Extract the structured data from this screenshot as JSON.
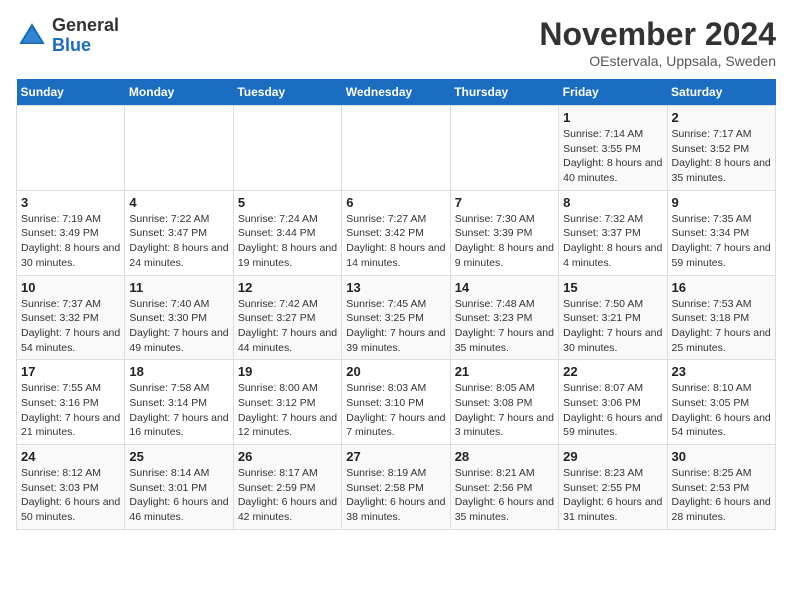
{
  "logo": {
    "general": "General",
    "blue": "Blue"
  },
  "title": "November 2024",
  "subtitle": "OEstervala, Uppsala, Sweden",
  "days_of_week": [
    "Sunday",
    "Monday",
    "Tuesday",
    "Wednesday",
    "Thursday",
    "Friday",
    "Saturday"
  ],
  "weeks": [
    [
      {
        "day": "",
        "info": ""
      },
      {
        "day": "",
        "info": ""
      },
      {
        "day": "",
        "info": ""
      },
      {
        "day": "",
        "info": ""
      },
      {
        "day": "",
        "info": ""
      },
      {
        "day": "1",
        "info": "Sunrise: 7:14 AM\nSunset: 3:55 PM\nDaylight: 8 hours and 40 minutes."
      },
      {
        "day": "2",
        "info": "Sunrise: 7:17 AM\nSunset: 3:52 PM\nDaylight: 8 hours and 35 minutes."
      }
    ],
    [
      {
        "day": "3",
        "info": "Sunrise: 7:19 AM\nSunset: 3:49 PM\nDaylight: 8 hours and 30 minutes."
      },
      {
        "day": "4",
        "info": "Sunrise: 7:22 AM\nSunset: 3:47 PM\nDaylight: 8 hours and 24 minutes."
      },
      {
        "day": "5",
        "info": "Sunrise: 7:24 AM\nSunset: 3:44 PM\nDaylight: 8 hours and 19 minutes."
      },
      {
        "day": "6",
        "info": "Sunrise: 7:27 AM\nSunset: 3:42 PM\nDaylight: 8 hours and 14 minutes."
      },
      {
        "day": "7",
        "info": "Sunrise: 7:30 AM\nSunset: 3:39 PM\nDaylight: 8 hours and 9 minutes."
      },
      {
        "day": "8",
        "info": "Sunrise: 7:32 AM\nSunset: 3:37 PM\nDaylight: 8 hours and 4 minutes."
      },
      {
        "day": "9",
        "info": "Sunrise: 7:35 AM\nSunset: 3:34 PM\nDaylight: 7 hours and 59 minutes."
      }
    ],
    [
      {
        "day": "10",
        "info": "Sunrise: 7:37 AM\nSunset: 3:32 PM\nDaylight: 7 hours and 54 minutes."
      },
      {
        "day": "11",
        "info": "Sunrise: 7:40 AM\nSunset: 3:30 PM\nDaylight: 7 hours and 49 minutes."
      },
      {
        "day": "12",
        "info": "Sunrise: 7:42 AM\nSunset: 3:27 PM\nDaylight: 7 hours and 44 minutes."
      },
      {
        "day": "13",
        "info": "Sunrise: 7:45 AM\nSunset: 3:25 PM\nDaylight: 7 hours and 39 minutes."
      },
      {
        "day": "14",
        "info": "Sunrise: 7:48 AM\nSunset: 3:23 PM\nDaylight: 7 hours and 35 minutes."
      },
      {
        "day": "15",
        "info": "Sunrise: 7:50 AM\nSunset: 3:21 PM\nDaylight: 7 hours and 30 minutes."
      },
      {
        "day": "16",
        "info": "Sunrise: 7:53 AM\nSunset: 3:18 PM\nDaylight: 7 hours and 25 minutes."
      }
    ],
    [
      {
        "day": "17",
        "info": "Sunrise: 7:55 AM\nSunset: 3:16 PM\nDaylight: 7 hours and 21 minutes."
      },
      {
        "day": "18",
        "info": "Sunrise: 7:58 AM\nSunset: 3:14 PM\nDaylight: 7 hours and 16 minutes."
      },
      {
        "day": "19",
        "info": "Sunrise: 8:00 AM\nSunset: 3:12 PM\nDaylight: 7 hours and 12 minutes."
      },
      {
        "day": "20",
        "info": "Sunrise: 8:03 AM\nSunset: 3:10 PM\nDaylight: 7 hours and 7 minutes."
      },
      {
        "day": "21",
        "info": "Sunrise: 8:05 AM\nSunset: 3:08 PM\nDaylight: 7 hours and 3 minutes."
      },
      {
        "day": "22",
        "info": "Sunrise: 8:07 AM\nSunset: 3:06 PM\nDaylight: 6 hours and 59 minutes."
      },
      {
        "day": "23",
        "info": "Sunrise: 8:10 AM\nSunset: 3:05 PM\nDaylight: 6 hours and 54 minutes."
      }
    ],
    [
      {
        "day": "24",
        "info": "Sunrise: 8:12 AM\nSunset: 3:03 PM\nDaylight: 6 hours and 50 minutes."
      },
      {
        "day": "25",
        "info": "Sunrise: 8:14 AM\nSunset: 3:01 PM\nDaylight: 6 hours and 46 minutes."
      },
      {
        "day": "26",
        "info": "Sunrise: 8:17 AM\nSunset: 2:59 PM\nDaylight: 6 hours and 42 minutes."
      },
      {
        "day": "27",
        "info": "Sunrise: 8:19 AM\nSunset: 2:58 PM\nDaylight: 6 hours and 38 minutes."
      },
      {
        "day": "28",
        "info": "Sunrise: 8:21 AM\nSunset: 2:56 PM\nDaylight: 6 hours and 35 minutes."
      },
      {
        "day": "29",
        "info": "Sunrise: 8:23 AM\nSunset: 2:55 PM\nDaylight: 6 hours and 31 minutes."
      },
      {
        "day": "30",
        "info": "Sunrise: 8:25 AM\nSunset: 2:53 PM\nDaylight: 6 hours and 28 minutes."
      }
    ]
  ]
}
